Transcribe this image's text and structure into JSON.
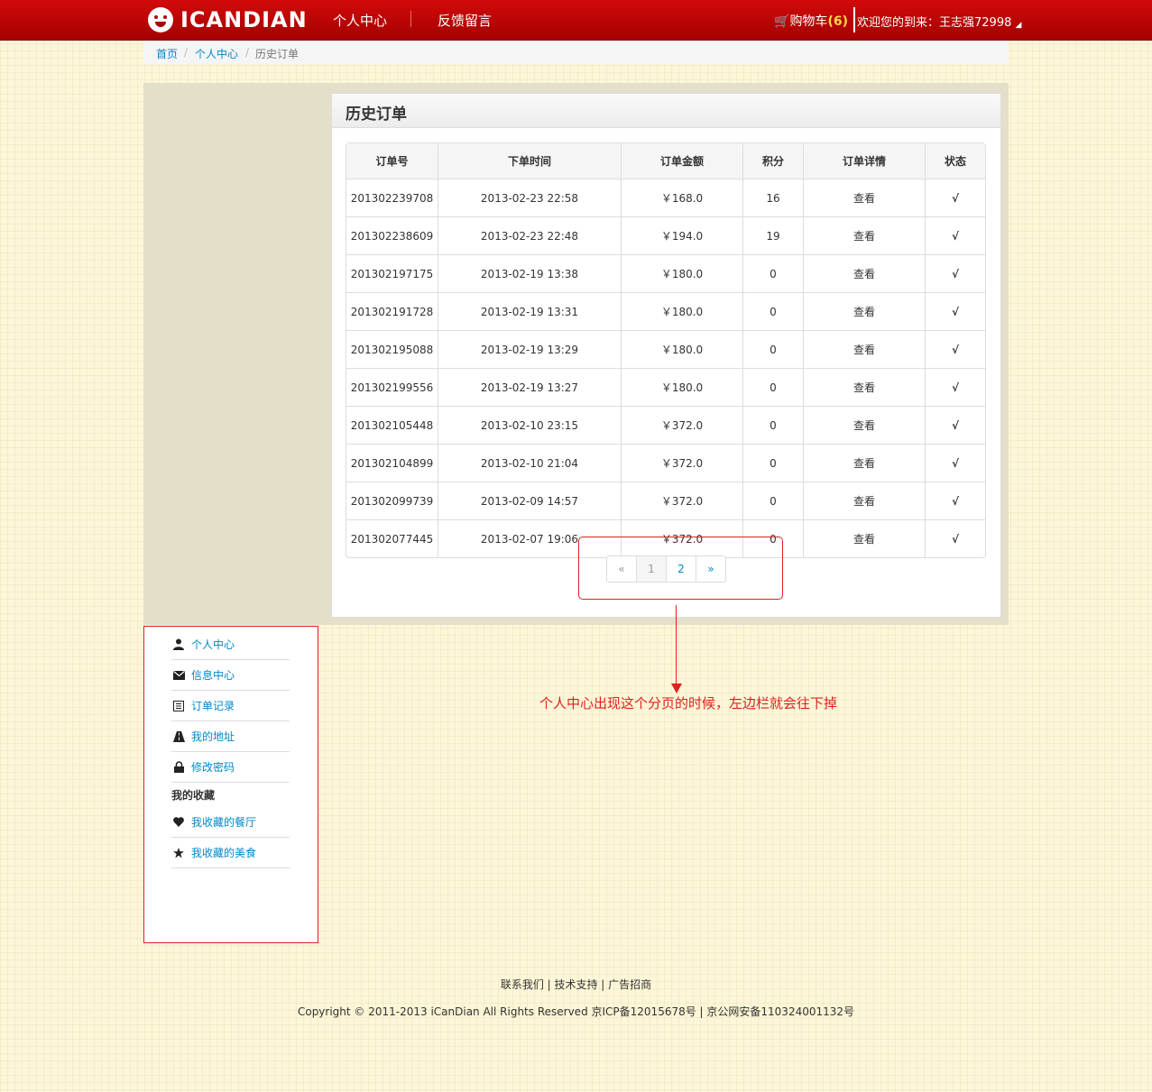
{
  "header": {
    "logo_text": "ICANDIAN",
    "nav": [
      "个人中心",
      "反馈留言"
    ],
    "cart_label": "购物车",
    "cart_count": "(6)",
    "welcome": "欢迎您的到来：王志强72998"
  },
  "breadcrumb": [
    "首页",
    "个人中心",
    "历史订单"
  ],
  "panel": {
    "title": "历史订单",
    "columns": [
      "订单号",
      "下单时间",
      "订单金额",
      "积分",
      "订单详情",
      "状态"
    ],
    "rows": [
      {
        "id": "201302239708",
        "time": "2013-02-23 22:58",
        "amount": "￥168.0",
        "points": "16",
        "detail": "查看",
        "status": "√"
      },
      {
        "id": "201302238609",
        "time": "2013-02-23 22:48",
        "amount": "￥194.0",
        "points": "19",
        "detail": "查看",
        "status": "√"
      },
      {
        "id": "201302197175",
        "time": "2013-02-19 13:38",
        "amount": "￥180.0",
        "points": "0",
        "detail": "查看",
        "status": "√"
      },
      {
        "id": "201302191728",
        "time": "2013-02-19 13:31",
        "amount": "￥180.0",
        "points": "0",
        "detail": "查看",
        "status": "√"
      },
      {
        "id": "201302195088",
        "time": "2013-02-19 13:29",
        "amount": "￥180.0",
        "points": "0",
        "detail": "查看",
        "status": "√"
      },
      {
        "id": "201302199556",
        "time": "2013-02-19 13:27",
        "amount": "￥180.0",
        "points": "0",
        "detail": "查看",
        "status": "√"
      },
      {
        "id": "201302105448",
        "time": "2013-02-10 23:15",
        "amount": "￥372.0",
        "points": "0",
        "detail": "查看",
        "status": "√"
      },
      {
        "id": "201302104899",
        "time": "2013-02-10 21:04",
        "amount": "￥372.0",
        "points": "0",
        "detail": "查看",
        "status": "√"
      },
      {
        "id": "201302099739",
        "time": "2013-02-09 14:57",
        "amount": "￥372.0",
        "points": "0",
        "detail": "查看",
        "status": "√"
      },
      {
        "id": "201302077445",
        "time": "2013-02-07 19:06",
        "amount": "￥372.0",
        "points": "0",
        "detail": "查看",
        "status": "√"
      }
    ]
  },
  "pagination": {
    "prev": "«",
    "pages": [
      "1",
      "2"
    ],
    "next": "»",
    "active": "1"
  },
  "annotation": "个人中心出现这个分页的时候，左边栏就会往下掉",
  "sidebar": {
    "items": [
      {
        "label": "个人中心",
        "icon": "user-icon"
      },
      {
        "label": "信息中心",
        "icon": "envelope-icon"
      },
      {
        "label": "订单记录",
        "icon": "list-icon"
      },
      {
        "label": "我的地址",
        "icon": "road-icon"
      },
      {
        "label": "修改密码",
        "icon": "lock-icon"
      }
    ],
    "heading": "我的收藏",
    "favorites": [
      {
        "label": "我收藏的餐厅",
        "icon": "heart-icon"
      },
      {
        "label": "我收藏的美食",
        "icon": "star-icon"
      }
    ]
  },
  "footer": {
    "links": "联系我们 | 技术支持 | 广告招商",
    "copyright": "Copyright © 2011-2013 iCanDian All Rights Reserved 京ICP备12015678号 | 京公网安备110324001132号"
  },
  "colors": {
    "brand": "#c00000",
    "link": "#0088cc",
    "order_id": "#e56f1f",
    "check": "#2aa022",
    "annotation": "#e02020"
  }
}
